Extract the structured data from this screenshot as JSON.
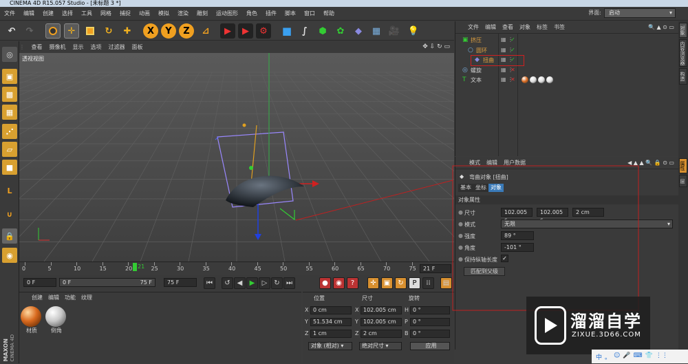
{
  "title": "CINEMA 4D R15.057 Studio - [未标题 3 *]",
  "menu": [
    "文件",
    "编辑",
    "创建",
    "选择",
    "工具",
    "网格",
    "捕捉",
    "动画",
    "模拟",
    "渲染",
    "雕刻",
    "运动图形",
    "角色",
    "插件",
    "脚本",
    "窗口",
    "帮助"
  ],
  "layout": {
    "label": "界面:",
    "value": "启动"
  },
  "toolbar": {
    "x": "X",
    "y": "Y",
    "z": "Z"
  },
  "viewport": {
    "menu": [
      "查看",
      "摄像机",
      "显示",
      "选项",
      "过滤器",
      "面板"
    ],
    "label": "透视视图"
  },
  "timeline": {
    "ticks": [
      "0",
      "5",
      "10",
      "15",
      "20",
      "25",
      "30",
      "35",
      "40",
      "45",
      "50",
      "55",
      "60",
      "65",
      "70",
      "75"
    ],
    "current": "21",
    "frame_display": "21 F"
  },
  "transport": {
    "start": "0 F",
    "range_start": "0 F",
    "range_end": "75 F",
    "end": "75 F"
  },
  "materials": {
    "menu": [
      "创建",
      "编辑",
      "功能",
      "纹理"
    ],
    "items": [
      {
        "label": "材质",
        "color": "#d8691e"
      },
      {
        "label": "倒角",
        "color": "#c8c8c8"
      }
    ]
  },
  "brand": {
    "line1": "MAXON",
    "line2": "CINEMA 4D"
  },
  "coords": {
    "headers": [
      "位置",
      "尺寸",
      "旋转"
    ],
    "rows": [
      {
        "a": "X",
        "pos": "0 cm",
        "b": "X",
        "size": "102.005 cm",
        "c": "H",
        "rot": "0 °"
      },
      {
        "a": "Y",
        "pos": "51.534 cm",
        "b": "Y",
        "size": "102.005 cm",
        "c": "P",
        "rot": "0 °"
      },
      {
        "a": "Z",
        "pos": "1 cm",
        "b": "Z",
        "size": "2 cm",
        "c": "B",
        "rot": "0 °"
      }
    ],
    "mode": "对象 (相对)",
    "sizemode": "绝对尺寸",
    "apply": "应用"
  },
  "objects": {
    "menu": [
      "文件",
      "编辑",
      "查看",
      "对象",
      "标签",
      "书签"
    ],
    "items": [
      {
        "name": "挤压",
        "color": "#e0a040"
      },
      {
        "name": "圆环",
        "color": "#e0a040"
      },
      {
        "name": "扭曲",
        "color": "#e0a040"
      },
      {
        "name": "螺旋",
        "color": "#cfcfcf"
      },
      {
        "name": "文本",
        "color": "#cfcfcf"
      }
    ]
  },
  "attributes": {
    "menu": [
      "模式",
      "编辑",
      "用户数据"
    ],
    "title": "弯曲对象 [扭曲]",
    "tabs": [
      "基本",
      "坐标",
      "对象"
    ],
    "section": "对象属性",
    "size_label": "尺寸",
    "size_vals": [
      "102.005 c",
      "102.005 c",
      "2 cm"
    ],
    "mode_label": "模式",
    "mode_val": "无限",
    "strength_label": "强度",
    "strength_val": "89 °",
    "angle_label": "角度",
    "angle_val": "-101 °",
    "keep_label": "保持纵轴长度",
    "keep_val": "✓",
    "match_btn": "匹配到父级"
  },
  "right_tabs": [
    "对象",
    "内容浏览器",
    "构造",
    "属性",
    "层"
  ],
  "watermark": {
    "cn": "溜溜自学",
    "url": "ZIXUE.3D66.COM"
  },
  "taskbar": [
    "中",
    "。",
    "☺",
    "🎤",
    "⌨",
    "👕",
    "⋮⋮"
  ]
}
